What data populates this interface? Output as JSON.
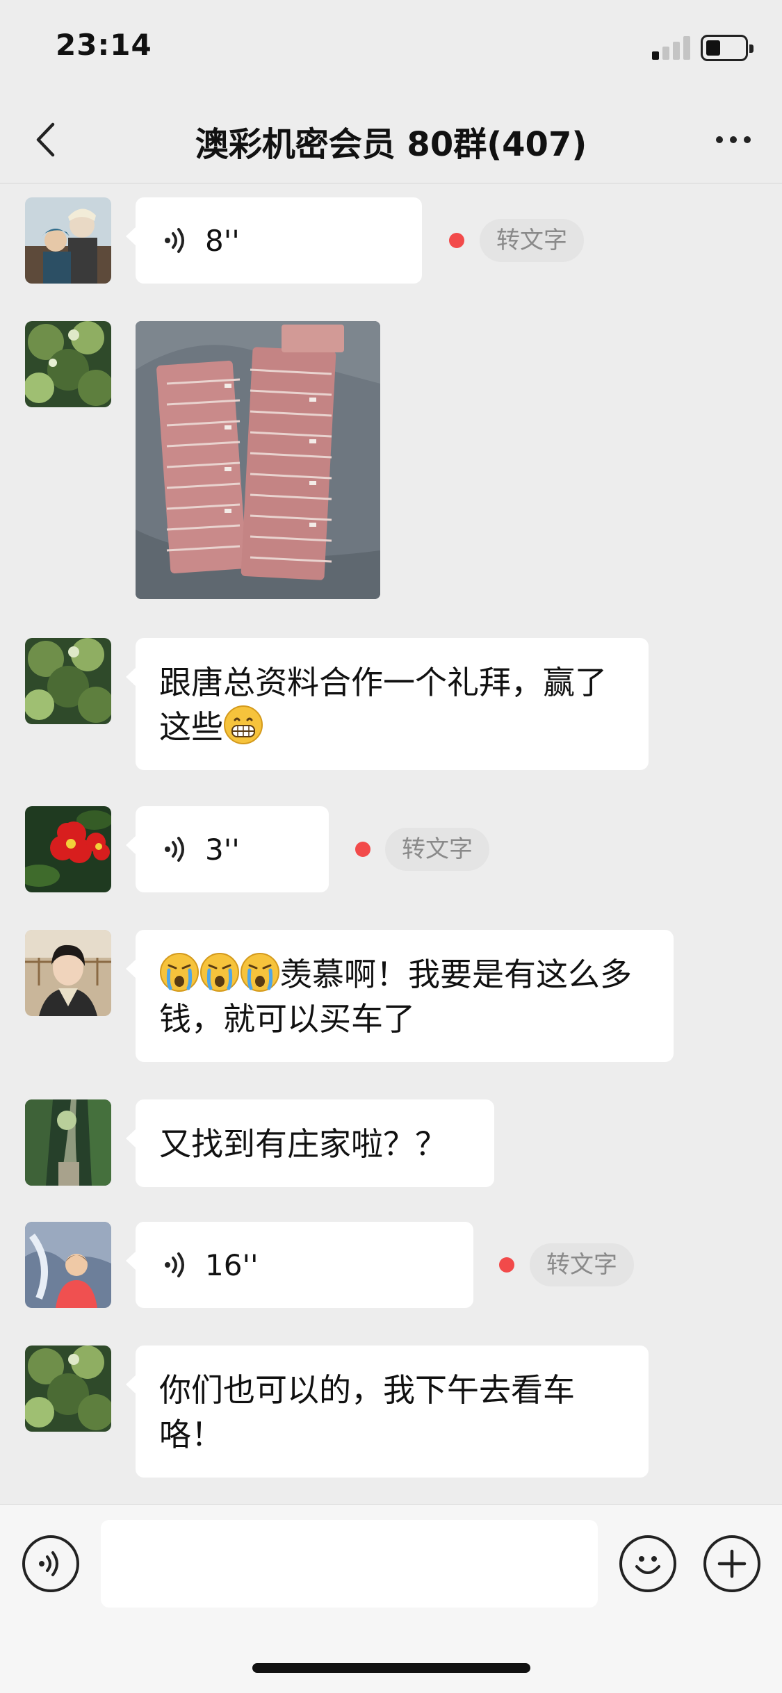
{
  "status_bar": {
    "time": "23:14"
  },
  "nav": {
    "title": "澳彩机密会员 80群(407)"
  },
  "messages": [
    {
      "type": "voice",
      "duration": "8''",
      "transcribe": "转文字"
    },
    {
      "type": "image",
      "description": "stacks-of-banknotes"
    },
    {
      "type": "text",
      "text_before": "跟唐总资料合作一个礼拜，赢了这些",
      "emoji": "grinning-face"
    },
    {
      "type": "voice",
      "duration": "3''",
      "transcribe": "转文字"
    },
    {
      "type": "text",
      "emoji": "crying-face x3",
      "text_after": "羡慕啊！我要是有这么多钱，就可以买车了"
    },
    {
      "type": "text",
      "text": "又找到有庄家啦？？"
    },
    {
      "type": "voice",
      "duration": "16''",
      "transcribe": "转文字"
    },
    {
      "type": "text",
      "text": "你们也可以的，我下午去看车咯！"
    }
  ],
  "input": {
    "value": "",
    "placeholder": ""
  },
  "icons": {
    "back": "chevron-left-icon",
    "more": "more-dots-icon",
    "voice_wave": "voice-wave-icon",
    "voice_toggle": "voice-input-icon",
    "emoji": "smiley-icon",
    "add": "plus-icon"
  },
  "colors": {
    "background": "#ededed",
    "bubble": "#ffffff",
    "unread_dot": "#f24a4a",
    "input_bar": "#f6f6f6"
  }
}
